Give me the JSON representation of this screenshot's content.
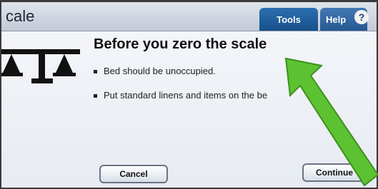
{
  "header": {
    "app_title": "cale",
    "tabs": [
      {
        "label": "Tools"
      },
      {
        "label": "Help"
      }
    ],
    "help_icon_glyph": "?"
  },
  "main": {
    "heading": "Before you zero the scale",
    "bullets": [
      "Bed should be unoccupied.",
      "Put standard linens and items on the be"
    ],
    "icon": "balance-scale-icon"
  },
  "buttons": {
    "cancel_label": "Cancel",
    "continue_label": "Continue"
  },
  "overlay": {
    "annotation": "green-arrow-icon",
    "color": "#5cc232"
  },
  "colors": {
    "tab_active": "#2b6fb0",
    "tab_inactive": "#255891"
  }
}
